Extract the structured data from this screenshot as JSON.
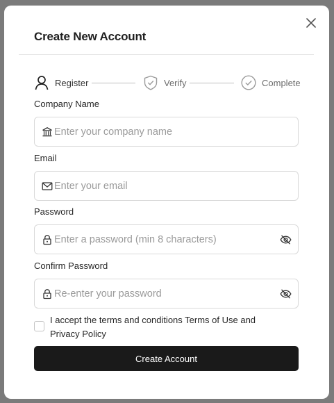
{
  "modal": {
    "title": "Create New Account",
    "close_icon": "close-icon"
  },
  "steps": [
    {
      "label": "Register",
      "icon": "user-icon",
      "state": "active"
    },
    {
      "label": "Verify",
      "icon": "shield-check-icon",
      "state": "inactive"
    },
    {
      "label": "Complete",
      "icon": "check-circle-icon",
      "state": "inactive"
    }
  ],
  "form": {
    "company": {
      "label": "Company Name",
      "placeholder": "Enter your company name",
      "value": "",
      "icon": "building-icon"
    },
    "email": {
      "label": "Email",
      "placeholder": "Enter your email",
      "value": "",
      "icon": "mail-icon"
    },
    "password": {
      "label": "Password",
      "placeholder": "Enter a password (min 8 characters)",
      "value": "",
      "icon": "lock-icon",
      "toggle_icon": "eye-off-icon"
    },
    "confirm_password": {
      "label": "Confirm Password",
      "placeholder": "Re-enter your password",
      "value": "",
      "icon": "lock-icon",
      "toggle_icon": "eye-off-icon"
    },
    "terms": {
      "text": "I accept the terms and conditions Terms of Use and Privacy Policy",
      "checked": false
    },
    "submit_label": "Create Account"
  },
  "colors": {
    "overlay": "#7b7b7b",
    "button_bg": "#1a1a1a",
    "button_text": "#ffffff",
    "border": "#d9d9d9"
  }
}
